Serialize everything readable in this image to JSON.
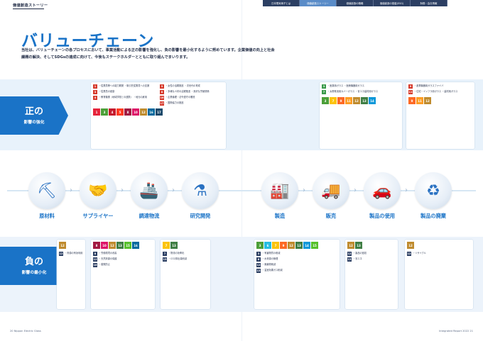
{
  "header": {
    "section_label": "価値創造ストーリー",
    "tabs": [
      "日本電気硝子とは",
      "価値創造ストーリー",
      "価値創造の戦略",
      "価値創造の基盤(ESG)",
      "財務・会社情報"
    ]
  },
  "title": "バリューチェーン",
  "intro": "当社は、バリューチェーンの各プロセスにおいて、事業活動による正の影響を強化し、負の影響を最小化するように努めています。企業価値の向上と社会課題の解決、そしてSDGsの達成に向けて、今後もステークホルダーとともに取り組んでまいります。",
  "positive": {
    "big": "正の",
    "small": "影響の強化"
  },
  "negative": {
    "big": "負の",
    "small": "影響の最小化"
  },
  "stages": [
    {
      "label": "原材料",
      "icon": "excavator-icon",
      "glyph": "⛏"
    },
    {
      "label": "サプライヤー",
      "icon": "handshake-icon",
      "glyph": "🤝"
    },
    {
      "label": "調達物流",
      "icon": "ship-icon",
      "glyph": "🚢"
    },
    {
      "label": "研究開発",
      "icon": "flask-icon",
      "glyph": "⚗"
    },
    {
      "label": "製造",
      "icon": "factory-icon",
      "glyph": "🏭"
    },
    {
      "label": "販売",
      "icon": "truck-icon",
      "glyph": "🚚"
    },
    {
      "label": "製品の使用",
      "icon": "car-icon",
      "glyph": "🚗"
    },
    {
      "label": "製品の廃棄",
      "icon": "recycle-bin-icon",
      "glyph": "♻"
    }
  ],
  "pos_cards": {
    "left": {
      "col1": [
        {
          "n": "1",
          "t": "・従業員等への能力開発 ・取引先従業員への支援"
        },
        {
          "n": "3",
          "t": "・従業員の健康"
        },
        {
          "n": "4",
          "t": "・教育機関（地域学校との連携） ・地元の雇用"
        }
      ],
      "col2": [
        {
          "n": "5",
          "t": "・女性の活躍推進 ・次世代の育成"
        },
        {
          "n": "8",
          "t": "・多様な人材の活躍推進 ・良好な労使関係"
        },
        {
          "n": "16",
          "t": "・企業倫理・法令遵守の徹底"
        },
        {
          "n": "17",
          "t": "・国際協力の推進"
        }
      ],
      "sdgs": [
        "1",
        "3",
        "4",
        "5",
        "8",
        "10",
        "12",
        "16",
        "17"
      ]
    },
    "right1": {
      "items": [
        {
          "n": "3",
          "t": "・医薬用ガラス ・医療機器用ガラス"
        },
        {
          "n": "7",
          "t": "・太陽電池用カバーガラス ・省エネ建材用ガラス"
        }
      ],
      "sdgs": [
        "3",
        "7",
        "9",
        "11",
        "12",
        "13",
        "14"
      ]
    },
    "right2": {
      "items": [
        {
          "n": "9",
          "t": "・産業機器用ガラスファイバ"
        },
        {
          "n": "11",
          "t": "・住宅・インフラ用ガラス ・建材用ガラス"
        }
      ],
      "sdgs": [
        "9",
        "11",
        "12"
      ]
    }
  },
  "neg_cards": [
    {
      "items": [
        {
          "n": "12",
          "t": "・資源の有効利用"
        }
      ],
      "sdgs": [
        "12"
      ]
    },
    {
      "items": [
        {
          "n": "8",
          "t": "・労働環境の改善"
        },
        {
          "n": "12",
          "t": "・天然資源の保護"
        },
        {
          "n": "16",
          "t": "・腐敗防止"
        }
      ],
      "sdgs": [
        "8",
        "10",
        "12",
        "13",
        "15",
        "16"
      ]
    },
    {
      "items": [
        {
          "n": "7",
          "t": "・物流の効率化"
        },
        {
          "n": "13",
          "t": "・CO2排出量削減"
        }
      ],
      "sdgs": [
        "7",
        "13"
      ]
    },
    {
      "items": [
        {
          "n": "3",
          "t": "・有害物質の削減"
        },
        {
          "n": "6",
          "t": "・水資源の管理"
        },
        {
          "n": "12",
          "t": "・廃棄物削減"
        },
        {
          "n": "13",
          "t": "・温室効果ガス削減"
        }
      ],
      "sdgs": [
        "3",
        "6",
        "7",
        "9",
        "12",
        "13",
        "14",
        "15"
      ]
    },
    {
      "items": [
        {
          "n": "12",
          "t": "・製品の回収"
        },
        {
          "n": "13",
          "t": "・省エネ"
        }
      ],
      "sdgs": [
        "12",
        "13"
      ]
    },
    {
      "items": [
        {
          "n": "12",
          "t": "・リサイクル"
        }
      ],
      "sdgs": [
        "12"
      ]
    }
  ],
  "sdg_colors": {
    "1": "#e5243b",
    "3": "#4c9f38",
    "4": "#c5192d",
    "5": "#ff3a21",
    "6": "#26bde2",
    "7": "#fcc30b",
    "8": "#a21942",
    "9": "#fd6925",
    "10": "#dd1367",
    "11": "#fd9d24",
    "12": "#bf8b2e",
    "13": "#3f7e44",
    "14": "#0a97d9",
    "15": "#56c02b",
    "16": "#00689d",
    "17": "#19486a"
  },
  "footer": {
    "left": "20  Nippon Electric Glass",
    "right": "Integrated Report 2022  21"
  }
}
